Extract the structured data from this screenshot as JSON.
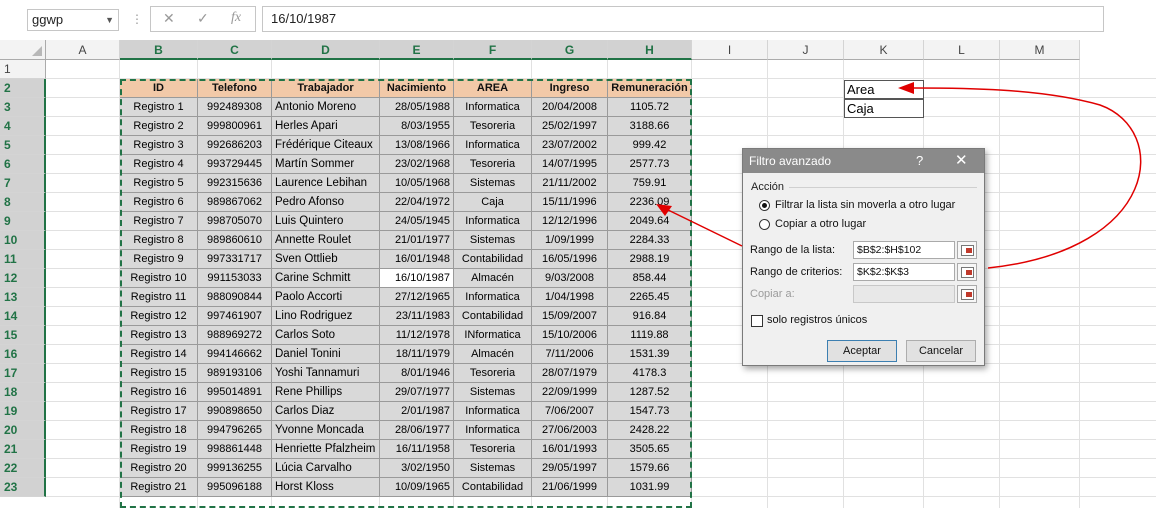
{
  "formula_bar": {
    "name_box": "ggwp",
    "cancel_icon": "✕",
    "enter_icon": "✓",
    "fx_icon": "fx",
    "formula": "16/10/1987"
  },
  "columns": [
    "A",
    "B",
    "C",
    "D",
    "E",
    "F",
    "G",
    "H",
    "I",
    "J",
    "K",
    "L",
    "M"
  ],
  "rows": [
    "1",
    "2",
    "3",
    "4",
    "5",
    "6",
    "7",
    "8",
    "9",
    "10",
    "11",
    "12",
    "13",
    "14",
    "15",
    "16",
    "17",
    "18",
    "19",
    "20",
    "21",
    "22",
    "23"
  ],
  "table": {
    "headers": [
      "ID",
      "Telefono",
      "Trabajador",
      "Nacimiento",
      "AREA",
      "Ingreso",
      "Remuneración"
    ],
    "rows": [
      [
        "Registro 1",
        "992489308",
        "Antonio Moreno",
        "28/05/1988",
        "Informatica",
        "20/04/2008",
        "1105.72"
      ],
      [
        "Registro 2",
        "999800961",
        "Herles Apari",
        "8/03/1955",
        "Tesoreria",
        "25/02/1997",
        "3188.66"
      ],
      [
        "Registro 3",
        "992686203",
        "Frédérique Citeaux",
        "13/08/1966",
        "Informatica",
        "23/07/2002",
        "999.42"
      ],
      [
        "Registro 4",
        "993729445",
        "Martín Sommer",
        "23/02/1968",
        "Tesoreria",
        "14/07/1995",
        "2577.73"
      ],
      [
        "Registro 5",
        "992315636",
        "Laurence Lebihan",
        "10/05/1968",
        "Sistemas",
        "21/11/2002",
        "759.91"
      ],
      [
        "Registro 6",
        "989867062",
        "Pedro Afonso",
        "22/04/1972",
        "Caja",
        "15/11/1996",
        "2236.09"
      ],
      [
        "Registro 7",
        "998705070",
        "Luis Quintero",
        "24/05/1945",
        "Informatica",
        "12/12/1996",
        "2049.64"
      ],
      [
        "Registro 8",
        "989860610",
        "Annette Roulet",
        "21/01/1977",
        "Sistemas",
        "1/09/1999",
        "2284.33"
      ],
      [
        "Registro 9",
        "997331717",
        "Sven Ottlieb",
        "16/01/1948",
        "Contabilidad",
        "16/05/1996",
        "2988.19"
      ],
      [
        "Registro 10",
        "991153033",
        "Carine Schmitt",
        "16/10/1987",
        "Almacén",
        "9/03/2008",
        "858.44"
      ],
      [
        "Registro 11",
        "988090844",
        "Paolo Accorti",
        "27/12/1965",
        "Informatica",
        "1/04/1998",
        "2265.45"
      ],
      [
        "Registro 12",
        "997461907",
        "Lino Rodriguez",
        "23/11/1983",
        "Contabilidad",
        "15/09/2007",
        "916.84"
      ],
      [
        "Registro 13",
        "988969272",
        "Carlos Soto",
        "11/12/1978",
        "INformatica",
        "15/10/2006",
        "1119.88"
      ],
      [
        "Registro 14",
        "994146662",
        "Daniel Tonini",
        "18/11/1979",
        "Almacén",
        "7/11/2006",
        "1531.39"
      ],
      [
        "Registro 15",
        "989193106",
        "Yoshi Tannamuri",
        "8/01/1946",
        "Tesoreria",
        "28/07/1979",
        "4178.3"
      ],
      [
        "Registro 16",
        "995014891",
        "Rene Phillips",
        "29/07/1977",
        "Sistemas",
        "22/09/1999",
        "1287.52"
      ],
      [
        "Registro 17",
        "990898650",
        "Carlos Diaz",
        "2/01/1987",
        "Informatica",
        "7/06/2007",
        "1547.73"
      ],
      [
        "Registro 18",
        "994796265",
        "Yvonne Moncada",
        "28/06/1977",
        "Informatica",
        "27/06/2003",
        "2428.22"
      ],
      [
        "Registro 19",
        "998861448",
        "Henriette Pfalzheim",
        "16/11/1958",
        "Tesoreria",
        "16/01/1993",
        "3505.65"
      ],
      [
        "Registro 20",
        "999136255",
        "Lúcia Carvalho",
        "3/02/1950",
        "Sistemas",
        "29/05/1997",
        "1579.66"
      ],
      [
        "Registro 21",
        "995096188",
        "Horst Kloss",
        "10/09/1965",
        "Contabilidad",
        "21/06/1999",
        "1031.99"
      ]
    ]
  },
  "criteria": {
    "header": "Area",
    "value": "Caja"
  },
  "dialog": {
    "title": "Filtro avanzado",
    "help": "?",
    "close": "✕",
    "group_label": "Acción",
    "option_filter": "Filtrar la lista sin moverla a otro lugar",
    "option_copy": "Copiar a otro lugar",
    "list_range_label": "Rango de la lista:",
    "list_range_value": "$B$2:$H$102",
    "criteria_range_label": "Rango de criterios:",
    "criteria_range_value": "$K$2:$K$3",
    "copy_to_label": "Copiar a:",
    "copy_to_value": "",
    "unique_label": "solo registros únicos",
    "accept": "Aceptar",
    "cancel": "Cancelar"
  },
  "colors": {
    "accent": "#217346",
    "header_fill": "#f2c9a8",
    "data_fill": "#d9d9d9",
    "arrow": "#e00000"
  }
}
